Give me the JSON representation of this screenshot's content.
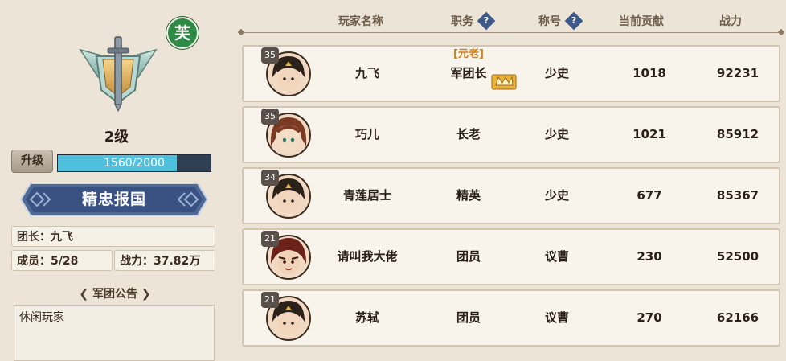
{
  "guild": {
    "level": "2级",
    "upgrade_label": "升级",
    "xp_text": "1560/2000",
    "xp_fraction": 0.78,
    "name": "精忠报国",
    "leader": "团长：九飞",
    "members": "成员：5/28",
    "power": "战力：37.82万",
    "badge_char": "芙",
    "notice_title": "军团公告",
    "notice_text": "休闲玩家"
  },
  "columns": {
    "name": "玩家名称",
    "role": "职务",
    "title": "称号",
    "contribution": "当前贡献",
    "power": "战力",
    "help_glyph": "?"
  },
  "members": [
    {
      "level": "35",
      "name": "九飞",
      "tag": "[元老]",
      "role": "军团长",
      "title": "少史",
      "contribution": "1018",
      "power": "92231"
    },
    {
      "level": "35",
      "name": "巧儿",
      "tag": "",
      "role": "长老",
      "title": "少史",
      "contribution": "1021",
      "power": "85912"
    },
    {
      "level": "34",
      "name": "青莲居士",
      "tag": "",
      "role": "精英",
      "title": "少史",
      "contribution": "677",
      "power": "85367"
    },
    {
      "level": "21",
      "name": "请叫我大佬",
      "tag": "",
      "role": "团员",
      "title": "议曹",
      "contribution": "230",
      "power": "52500"
    },
    {
      "level": "21",
      "name": "苏轼",
      "tag": "",
      "role": "团员",
      "title": "议曹",
      "contribution": "270",
      "power": "62166"
    }
  ],
  "colors": {
    "accent_blue": "#3e5a8a",
    "xp_fill": "#4fc0dc",
    "badge_green": "#2e8b45",
    "elder_orange": "#d0801a"
  },
  "icons": {
    "emblem": "sword-shield-emblem-icon",
    "help": "question-diamond-icon",
    "crown": "leader-crown-icon"
  }
}
